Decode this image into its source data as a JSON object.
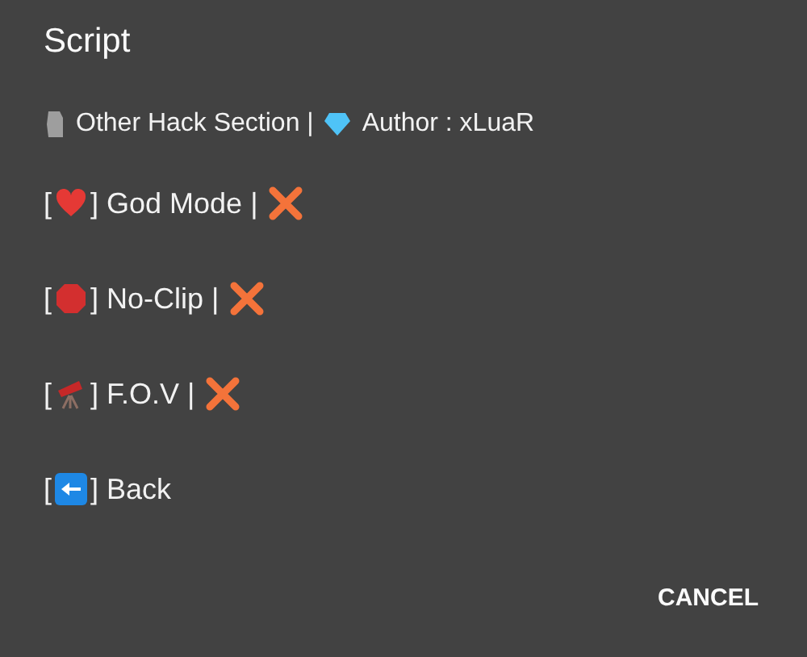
{
  "dialog": {
    "title": "Script",
    "header": [
      {
        "kind": "statue",
        "text": "Other Hack Section |"
      },
      {
        "kind": "diamond",
        "text": "Author : xLuaR"
      }
    ],
    "items": [
      {
        "open": "[",
        "kind": "heart",
        "label": "] God Mode |",
        "enabled": false
      },
      {
        "open": "[",
        "kind": "stop",
        "label": "] No-Clip |",
        "enabled": false
      },
      {
        "open": "[",
        "kind": "telescope",
        "label": "] F.O.V |",
        "enabled": false
      },
      {
        "open": "[",
        "kind": "back",
        "label": "] Back"
      }
    ],
    "button": "CANCEL"
  }
}
